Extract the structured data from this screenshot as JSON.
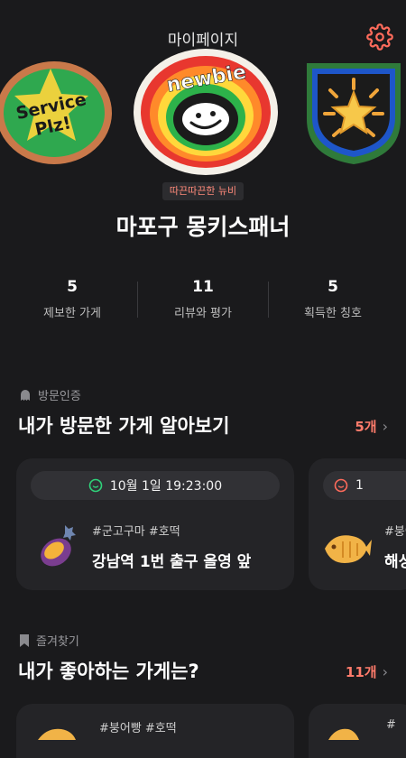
{
  "header": {
    "title": "마이페이지"
  },
  "icons": {
    "settings": "gear-icon",
    "visit": "ghost-icon",
    "bookmark": "bookmark-icon",
    "clock": "clock-icon"
  },
  "badges": [
    {
      "text_line1": "Service",
      "text_line2": "Plz!"
    },
    {
      "text_line1": "newbie"
    },
    {
      "name": "star-shield"
    }
  ],
  "profile": {
    "nickname_title": "따끈따끈한 뉴비",
    "username": "마포구 몽키스패너"
  },
  "stats": [
    {
      "value": "5",
      "label": "제보한 가게"
    },
    {
      "value": "11",
      "label": "리뷰와 평가"
    },
    {
      "value": "5",
      "label": "획득한 칭호"
    }
  ],
  "visited": {
    "label": "방문인증",
    "title": "내가 방문한 가게 알아보기",
    "count": "5개",
    "cards": [
      {
        "date": "10월 1일 19:23:00",
        "tags": "#군고구마 #호떡",
        "store": "강남역 1번 출구 올영 앞"
      },
      {
        "date": "1",
        "tags": "#붕어",
        "store": "해성"
      }
    ]
  },
  "favorites": {
    "label": "즐겨찾기",
    "title": "내가 좋아하는 가게는?",
    "count": "11개",
    "cards": [
      {
        "tags": "#붕어빵 #호떡"
      },
      {
        "tags": "#"
      }
    ]
  },
  "colors": {
    "accent": "#ff7b6b",
    "background": "#1a1a1c",
    "card": "#242427",
    "visit_icon": "#2fd27a"
  }
}
